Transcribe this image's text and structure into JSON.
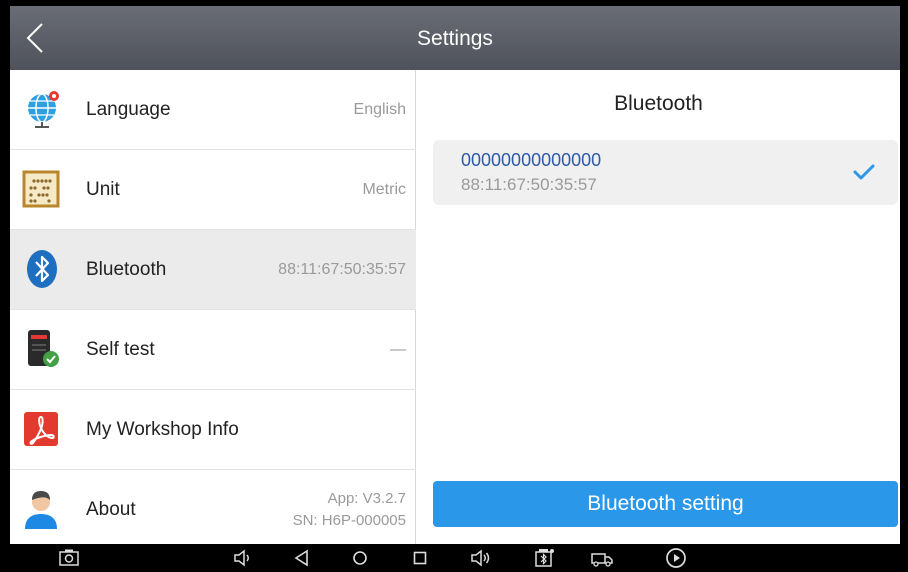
{
  "header": {
    "title": "Settings"
  },
  "menu": [
    {
      "label": "Language",
      "value": "English",
      "icon": "globe-icon"
    },
    {
      "label": "Unit",
      "value": "Metric",
      "icon": "abacus-icon"
    },
    {
      "label": "Bluetooth",
      "value": "88:11:67:50:35:57",
      "icon": "bluetooth-icon"
    },
    {
      "label": "Self test",
      "value": "—",
      "icon": "self-test-icon"
    },
    {
      "label": "My Workshop Info",
      "value": "",
      "icon": "pdf-icon"
    },
    {
      "label": "About",
      "value_line1": "App: V3.2.7",
      "value_line2": "SN: H6P-000005",
      "icon": "user-icon"
    }
  ],
  "bluetooth_panel": {
    "title": "Bluetooth",
    "device": {
      "name": "00000000000000",
      "address": "88:11:67:50:35:57",
      "selected": true
    },
    "setting_button": "Bluetooth setting"
  },
  "colors": {
    "accent": "#2b97e8",
    "titlebar": "#5c5f67",
    "selected_row": "#ebebeb",
    "device_name": "#2d5aa5"
  },
  "navbar_icons": [
    "screenshot-icon",
    "volume-down-icon",
    "back-triangle-icon",
    "home-circle-icon",
    "recent-apps-icon",
    "volume-up-icon",
    "vci-icon",
    "truck-icon",
    "play-icon"
  ]
}
